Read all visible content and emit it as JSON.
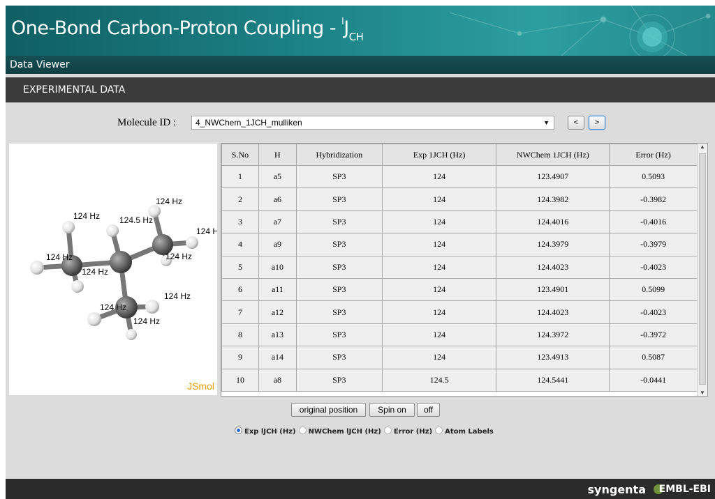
{
  "header": {
    "title_main": "One-Bond Carbon-Proton Coupling - ",
    "title_sup": "l",
    "title_j": "J",
    "title_sub": "CH"
  },
  "subbar": {
    "label": "Data Viewer"
  },
  "section": {
    "label": "EXPERIMENTAL DATA"
  },
  "molecule": {
    "label": "Molecule ID :",
    "selected": "4_NWChem_1JCH_mulliken",
    "prev_label": "<",
    "next_label": ">"
  },
  "viewer": {
    "brand": "JSmol",
    "atom_labels": [
      "124 Hz",
      "124 Hz",
      "124.5 Hz",
      "124 H",
      "124 Hz",
      "124 Hz",
      "124 Hz",
      "124 Hz",
      "124 Hz",
      "124 Hz"
    ]
  },
  "table": {
    "columns": [
      "S.No",
      "H",
      "Hybridization",
      "Exp 1JCH (Hz)",
      "NWChem 1JCH (Hz)",
      "Error (Hz)"
    ],
    "rows": [
      [
        "1",
        "a5",
        "SP3",
        "124",
        "123.4907",
        "0.5093"
      ],
      [
        "2",
        "a6",
        "SP3",
        "124",
        "124.3982",
        "-0.3982"
      ],
      [
        "3",
        "a7",
        "SP3",
        "124",
        "124.4016",
        "-0.4016"
      ],
      [
        "4",
        "a9",
        "SP3",
        "124",
        "124.3979",
        "-0.3979"
      ],
      [
        "5",
        "a10",
        "SP3",
        "124",
        "124.4023",
        "-0.4023"
      ],
      [
        "6",
        "a11",
        "SP3",
        "124",
        "123.4901",
        "0.5099"
      ],
      [
        "7",
        "a12",
        "SP3",
        "124",
        "124.4023",
        "-0.4023"
      ],
      [
        "8",
        "a13",
        "SP3",
        "124",
        "124.3972",
        "-0.3972"
      ],
      [
        "9",
        "a14",
        "SP3",
        "124",
        "123.4913",
        "0.5087"
      ],
      [
        "10",
        "a8",
        "SP3",
        "124.5",
        "124.5441",
        "-0.0441"
      ]
    ]
  },
  "controls": {
    "original_position": "original position",
    "spin_on": "Spin on",
    "spin_off": "off"
  },
  "radios": {
    "options": [
      "Exp lJCH (Hz)",
      "NWChem lJCH (Hz)",
      "Error (Hz)",
      "Atom Labels"
    ],
    "selected_index": 0
  },
  "footer": {
    "brand1": "syngenta",
    "brand2": "EMBL-EBI"
  },
  "colors": {
    "banner": "#1d8589",
    "section": "#3b3b3b",
    "footer": "#2b2b2b",
    "jsmol": "#e8a000"
  }
}
